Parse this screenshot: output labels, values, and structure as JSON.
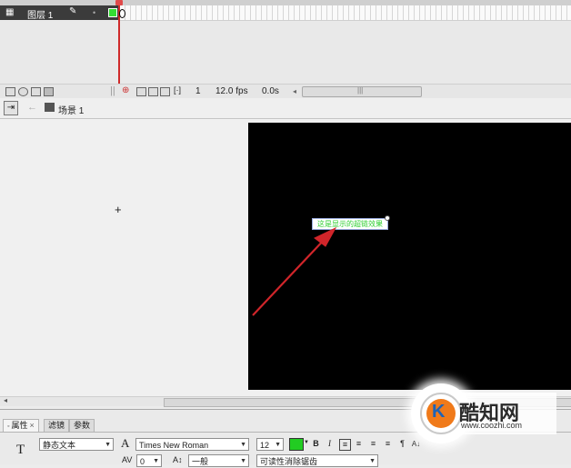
{
  "timeline": {
    "layer_name": "图层 1",
    "fps": "12.0 fps",
    "time": "0.0s",
    "current_frame": "1"
  },
  "editbar": {
    "scene_label": "场景 1"
  },
  "stage": {
    "text_content": "这是显示的超链效果"
  },
  "properties": {
    "tabs": [
      "属性",
      "滤镜",
      "参数"
    ],
    "text_type": "静态文本",
    "font_family": "Times New Roman",
    "font_size": "12",
    "letter_spacing": "0",
    "baseline": "一般",
    "rendering": "可读性消除锯齿",
    "color": "#22cc22",
    "bold": "B",
    "italic": "I",
    "type_glyph": "T",
    "font_glyph": "A"
  },
  "watermark": {
    "name": "酷知网",
    "url": "www.coozhi.com",
    "logo_letter": "K"
  },
  "colors": {
    "stage": "#000000",
    "arrow": "#d0252a",
    "playhead": "#cf2a2a"
  }
}
